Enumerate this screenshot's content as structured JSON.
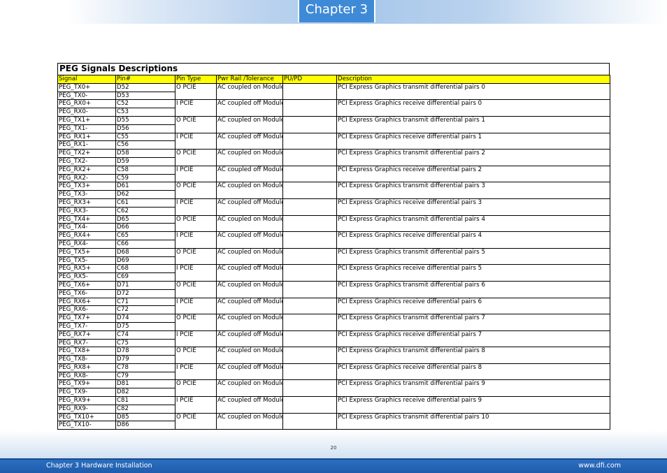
{
  "header": {
    "chapter_label": "Chapter 3"
  },
  "table": {
    "title": "PEG Signals Descriptions",
    "columns": [
      "Signal",
      "Pin#",
      "Pin Type",
      "Pwr Rail /Tolerance",
      "PU/PD",
      "Description"
    ],
    "groups": [
      {
        "signals": [
          "PEG_TX0+",
          "PEG_TX0-"
        ],
        "pins": [
          "D52",
          "D53"
        ],
        "pin_type": "O PCIE",
        "pwr_rail": "AC coupled on Module",
        "pupd": "",
        "description": "PCI Express Graphics transmit differential pairs 0"
      },
      {
        "signals": [
          "PEG_RX0+",
          "PEG_RX0-"
        ],
        "pins": [
          "C52",
          "C53"
        ],
        "pin_type": "I PCIE",
        "pwr_rail": "AC coupled off Module",
        "pupd": "",
        "description": "PCI Express Graphics receive differential pairs 0"
      },
      {
        "signals": [
          "PEG_TX1+",
          "PEG_TX1-"
        ],
        "pins": [
          "D55",
          "D56"
        ],
        "pin_type": "O PCIE",
        "pwr_rail": "AC coupled on Module",
        "pupd": "",
        "description": "PCI Express Graphics transmit differential pairs 1"
      },
      {
        "signals": [
          "PEG_RX1+",
          "PEG_RX1-"
        ],
        "pins": [
          "C55",
          "C56"
        ],
        "pin_type": "I PCIE",
        "pwr_rail": "AC coupled off Module",
        "pupd": "",
        "description": "PCI Express Graphics receive differential pairs 1"
      },
      {
        "signals": [
          "PEG_TX2+",
          "PEG_TX2-"
        ],
        "pins": [
          "D58",
          "D59"
        ],
        "pin_type": "O PCIE",
        "pwr_rail": "AC coupled on Module",
        "pupd": "",
        "description": "PCI Express Graphics transmit differential pairs 2"
      },
      {
        "signals": [
          "PEG_RX2+",
          "PEG_RX2-"
        ],
        "pins": [
          "C58",
          "C59"
        ],
        "pin_type": "I PCIE",
        "pwr_rail": "AC coupled off Module",
        "pupd": "",
        "description": "PCI Express Graphics receive differential pairs 2"
      },
      {
        "signals": [
          "PEG_TX3+",
          "PEG_TX3-"
        ],
        "pins": [
          "D61",
          "D62"
        ],
        "pin_type": "O PCIE",
        "pwr_rail": "AC coupled on Module",
        "pupd": "",
        "description": "PCI Express Graphics transmit differential pairs 3"
      },
      {
        "signals": [
          "PEG_RX3+",
          "PEG_RX3-"
        ],
        "pins": [
          "C61",
          "C62"
        ],
        "pin_type": "I PCIE",
        "pwr_rail": "AC coupled off Module",
        "pupd": "",
        "description": "PCI Express Graphics receive differential pairs 3"
      },
      {
        "signals": [
          "PEG_TX4+",
          "PEG_TX4-"
        ],
        "pins": [
          "D65",
          "D66"
        ],
        "pin_type": "O PCIE",
        "pwr_rail": "AC coupled on Module",
        "pupd": "",
        "description": "PCI Express Graphics transmit differential pairs 4"
      },
      {
        "signals": [
          "PEG_RX4+",
          "PEG_RX4-"
        ],
        "pins": [
          "C65",
          "C66"
        ],
        "pin_type": "I PCIE",
        "pwr_rail": "AC coupled off Module",
        "pupd": "",
        "description": "PCI Express Graphics receive differential pairs 4"
      },
      {
        "signals": [
          "PEG_TX5+",
          "PEG_TX5-"
        ],
        "pins": [
          "D68",
          "D69"
        ],
        "pin_type": "O PCIE",
        "pwr_rail": "AC coupled on Module",
        "pupd": "",
        "description": "PCI Express Graphics transmit differential pairs 5"
      },
      {
        "signals": [
          "PEG_RX5+",
          "PEG_RX5-"
        ],
        "pins": [
          "C68",
          "C69"
        ],
        "pin_type": "I PCIE",
        "pwr_rail": "AC coupled off Module",
        "pupd": "",
        "description": "PCI Express Graphics receive differential pairs 5"
      },
      {
        "signals": [
          "PEG_TX6+",
          "PEG_TX6-"
        ],
        "pins": [
          "D71",
          "D72"
        ],
        "pin_type": "O PCIE",
        "pwr_rail": "AC coupled on Module",
        "pupd": "",
        "description": "PCI Express Graphics transmit differential pairs 6"
      },
      {
        "signals": [
          "PEG_RX6+",
          "PEG_RX6-"
        ],
        "pins": [
          "C71",
          "C72"
        ],
        "pin_type": "I PCIE",
        "pwr_rail": "AC coupled off Module",
        "pupd": "",
        "description": "PCI Express Graphics receive differential pairs 6"
      },
      {
        "signals": [
          "PEG_TX7+",
          "PEG_TX7-"
        ],
        "pins": [
          "D74",
          "D75"
        ],
        "pin_type": "O PCIE",
        "pwr_rail": "AC coupled on Module",
        "pupd": "",
        "description": "PCI Express Graphics transmit differential pairs 7"
      },
      {
        "signals": [
          "PEG_RX7+",
          "PEG_RX7-"
        ],
        "pins": [
          "C74",
          "C75"
        ],
        "pin_type": "I PCIE",
        "pwr_rail": "AC coupled off Module",
        "pupd": "",
        "description": "PCI Express Graphics receive differential pairs 7"
      },
      {
        "signals": [
          "PEG_TX8+",
          "PEG_TX8-"
        ],
        "pins": [
          "D78",
          "D79"
        ],
        "pin_type": "O PCIE",
        "pwr_rail": "AC coupled on Module",
        "pupd": "",
        "description": "PCI Express Graphics transmit differential pairs 8"
      },
      {
        "signals": [
          "PEG_RX8+",
          "PEG_RX8-"
        ],
        "pins": [
          "C78",
          "C79"
        ],
        "pin_type": "I PCIE",
        "pwr_rail": "AC coupled off Module",
        "pupd": "",
        "description": "PCI Express Graphics receive differential pairs 8"
      },
      {
        "signals": [
          "PEG_TX9+",
          "PEG_TX9-"
        ],
        "pins": [
          "D81",
          "D82"
        ],
        "pin_type": "O PCIE",
        "pwr_rail": "AC coupled on Module",
        "pupd": "",
        "description": "PCI Express Graphics transmit differential pairs 9"
      },
      {
        "signals": [
          "PEG_RX9+",
          "PEG_RX9-"
        ],
        "pins": [
          "C81",
          "C82"
        ],
        "pin_type": "I PCIE",
        "pwr_rail": "AC coupled off Module",
        "pupd": "",
        "description": "PCI Express Graphics receive differential pairs 9"
      },
      {
        "signals": [
          "PEG_TX10+",
          "PEG_TX10-"
        ],
        "pins": [
          "D85",
          "D86"
        ],
        "pin_type": "O PCIE",
        "pwr_rail": "AC coupled on Module",
        "pupd": "",
        "description": "PCI Express Graphics transmit differential pairs 10"
      }
    ]
  },
  "page_number": "20",
  "footer": {
    "left_text": "Chapter 3 Hardware Installation",
    "right_text": "www.dfi.com"
  },
  "colors": {
    "header_row_bg": "#ffff00",
    "chapter_tab_bg": "#3f8ad6",
    "footer_bar_bg": "#2365b7"
  }
}
